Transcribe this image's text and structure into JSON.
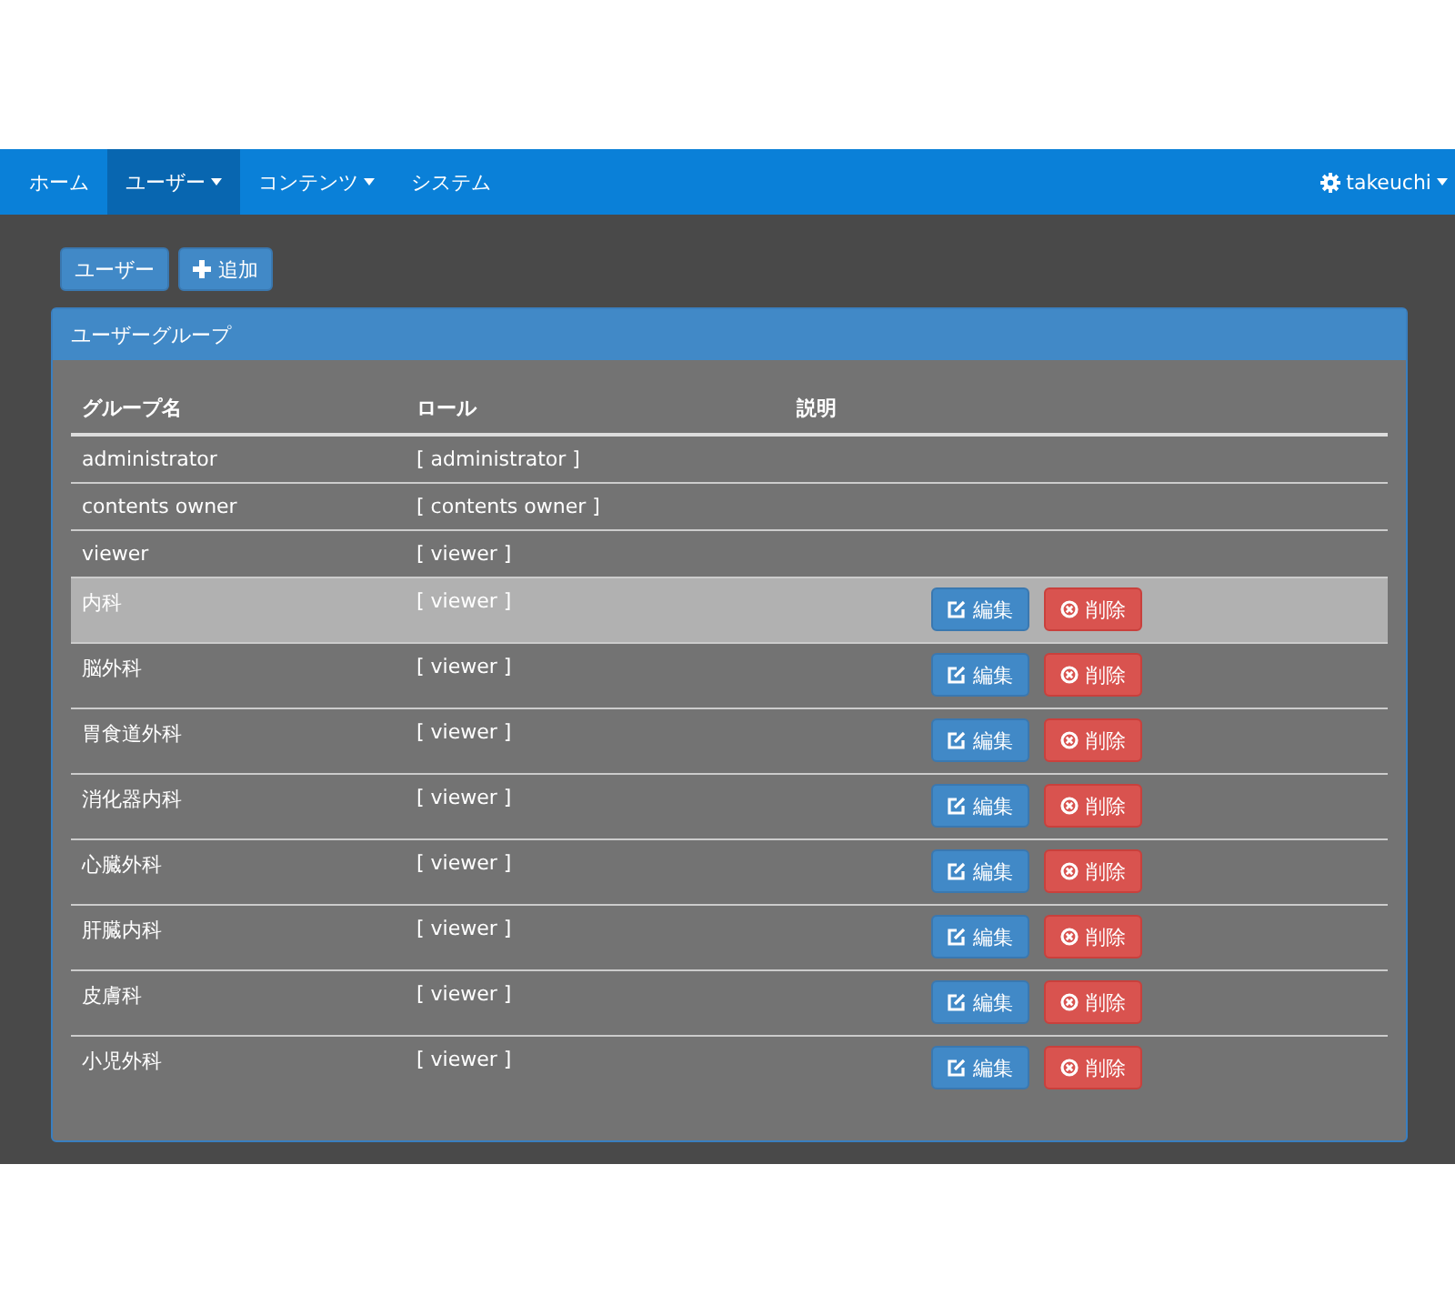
{
  "navbar": {
    "items": [
      {
        "label": "ホーム",
        "dropdown": false,
        "selected": false
      },
      {
        "label": "ユーザー",
        "dropdown": true,
        "selected": true
      },
      {
        "label": "コンテンツ",
        "dropdown": true,
        "selected": false
      },
      {
        "label": "システム",
        "dropdown": false,
        "selected": false
      }
    ],
    "user": {
      "label": "takeuchi",
      "dropdown": true
    }
  },
  "toolbar": [
    {
      "label": "ユーザー",
      "kind": "plain"
    },
    {
      "label": "追加",
      "kind": "add"
    }
  ],
  "panel": {
    "title": "ユーザーグループ",
    "table": {
      "columns": [
        "グループ名",
        "ロール",
        "説明"
      ],
      "rows": [
        {
          "name": "administrator",
          "role": "[ administrator ]",
          "selected": false,
          "actions": []
        },
        {
          "name": "contents owner",
          "role": "[ contents owner ]",
          "selected": false,
          "actions": []
        },
        {
          "name": "viewer",
          "role": "[ viewer ]",
          "selected": false,
          "actions": []
        },
        {
          "name": "内科",
          "role": "[ viewer ]",
          "selected": true,
          "actions": [
            {
              "label": "編集",
              "kind": "edit"
            },
            {
              "label": "削除",
              "kind": "delete"
            }
          ]
        },
        {
          "name": "脳外科",
          "role": "[ viewer ]",
          "selected": false,
          "actions": [
            {
              "label": "編集",
              "kind": "edit"
            },
            {
              "label": "削除",
              "kind": "delete"
            }
          ]
        },
        {
          "name": "胃食道外科",
          "role": "[ viewer ]",
          "selected": false,
          "actions": [
            {
              "label": "編集",
              "kind": "edit"
            },
            {
              "label": "削除",
              "kind": "delete"
            }
          ]
        },
        {
          "name": "消化器内科",
          "role": "[ viewer ]",
          "selected": false,
          "actions": [
            {
              "label": "編集",
              "kind": "edit"
            },
            {
              "label": "削除",
              "kind": "delete"
            }
          ]
        },
        {
          "name": "心臓外科",
          "role": "[ viewer ]",
          "selected": false,
          "actions": [
            {
              "label": "編集",
              "kind": "edit"
            },
            {
              "label": "削除",
              "kind": "delete"
            }
          ]
        },
        {
          "name": "肝臓内科",
          "role": "[ viewer ]",
          "selected": false,
          "actions": [
            {
              "label": "編集",
              "kind": "edit"
            },
            {
              "label": "削除",
              "kind": "delete"
            }
          ]
        },
        {
          "name": "皮膚科",
          "role": "[ viewer ]",
          "selected": false,
          "actions": [
            {
              "label": "編集",
              "kind": "edit"
            },
            {
              "label": "削除",
              "kind": "delete"
            }
          ]
        },
        {
          "name": "小児外科",
          "role": "[ viewer ]",
          "selected": false,
          "actions": [
            {
              "label": "編集",
              "kind": "edit"
            },
            {
              "label": "削除",
              "kind": "delete"
            }
          ]
        }
      ]
    }
  }
}
